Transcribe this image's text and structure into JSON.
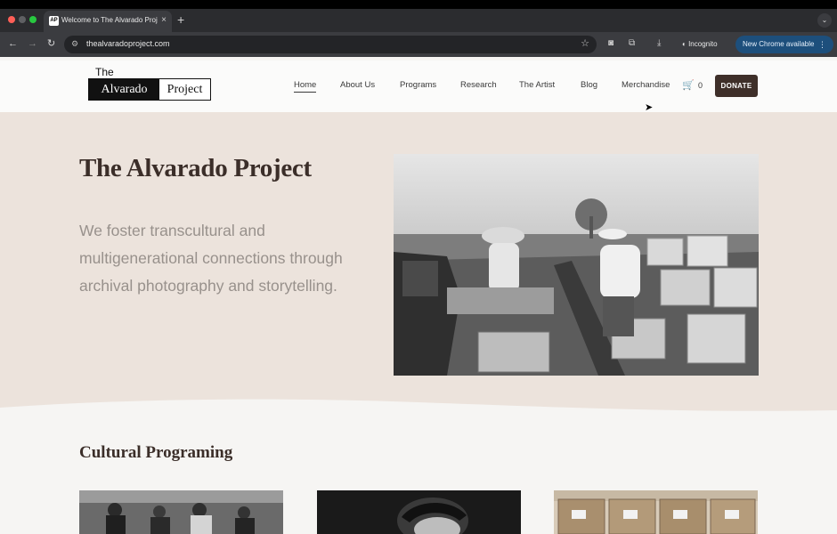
{
  "browser": {
    "tab_title": "Welcome to The Alvarado Proj",
    "tab_favicon": "AP",
    "tab_close": "×",
    "new_tab": "+",
    "url": "thealvaradoproject.com",
    "incognito_label": "Incognito",
    "update_label": "New Chrome available",
    "icons": [
      "back-icon",
      "forward-icon",
      "reload-icon",
      "site-info-icon",
      "bookmark-star-icon",
      "camera-icon",
      "extensions-icon",
      "download-icon",
      "incognito-icon",
      "menu-icon"
    ]
  },
  "site": {
    "logo": {
      "the": "The",
      "left": "Alvarado",
      "right": "Project"
    },
    "nav": [
      {
        "label": "Home",
        "active": true
      },
      {
        "label": "About Us"
      },
      {
        "label": "Programs"
      },
      {
        "label": "Research"
      },
      {
        "label": "The Artist"
      },
      {
        "label": "Blog"
      },
      {
        "label": "Merchandise"
      }
    ],
    "cart_count": "0",
    "donate_label": "DONATE",
    "colors": {
      "hero_bg": "#ece3dc",
      "donate_bg": "#3e2f29",
      "heading": "#3b2e29",
      "lede": "#98918c"
    }
  },
  "hero": {
    "title": "The Alvarado Project",
    "lede": "We foster transcultural and multigenerational connections through archival photography and storytelling."
  },
  "section": {
    "title": "Cultural Programing"
  }
}
